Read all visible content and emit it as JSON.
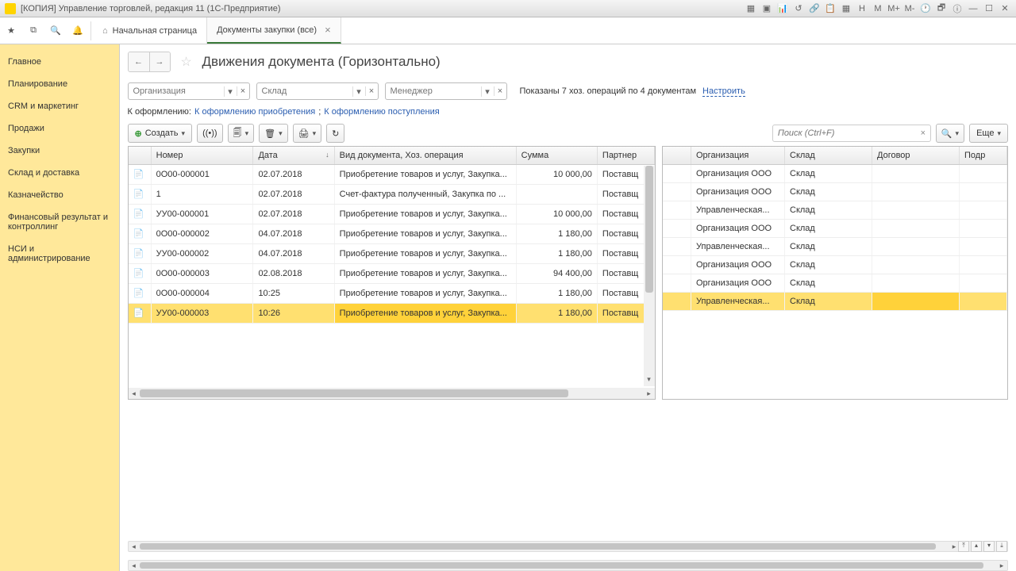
{
  "window": {
    "title": "[КОПИЯ] Управление торговлей, редакция 11 (1С-Предприятие)"
  },
  "tabs": {
    "home": "Начальная страница",
    "active": "Документы закупки (все)"
  },
  "nav": [
    "Главное",
    "Планирование",
    "CRM и маркетинг",
    "Продажи",
    "Закупки",
    "Склад и доставка",
    "Казначейство",
    "Финансовый результат и контроллинг",
    "НСИ и администрирование"
  ],
  "header": {
    "title": "Движения документа (Горизонтально)"
  },
  "filters": {
    "org_ph": "Организация",
    "sklad_ph": "Склад",
    "manager_ph": "Менеджер",
    "summary": "Показаны 7 хоз. операций по 4 документам",
    "configure": "Настроить"
  },
  "sublinks": {
    "label": "К оформлению:",
    "l1": "К оформлению приобретения",
    "l2": "К оформлению поступления"
  },
  "toolbar": {
    "create": "Создать",
    "search_ph": "Поиск (Ctrl+F)",
    "more": "Еще"
  },
  "cols_left": {
    "num": "Номер",
    "date": "Дата",
    "type": "Вид документа, Хоз. операция",
    "sum": "Сумма",
    "partner": "Партнер"
  },
  "cols_right": {
    "org": "Организация",
    "sklad": "Склад",
    "dogovor": "Договор",
    "podr": "Подр"
  },
  "rows_left": [
    {
      "num": "0О00-000001",
      "date": "02.07.2018",
      "type": "Приобретение товаров и услуг, Закупка...",
      "sum": "10 000,00",
      "partner": "Поставщ"
    },
    {
      "num": "1",
      "date": "02.07.2018",
      "type": "Счет-фактура полученный, Закупка по ...",
      "sum": "",
      "partner": "Поставщ"
    },
    {
      "num": "УУ00-000001",
      "date": "02.07.2018",
      "type": "Приобретение товаров и услуг, Закупка...",
      "sum": "10 000,00",
      "partner": "Поставщ"
    },
    {
      "num": "0О00-000002",
      "date": "04.07.2018",
      "type": "Приобретение товаров и услуг, Закупка...",
      "sum": "1 180,00",
      "partner": "Поставщ"
    },
    {
      "num": "УУ00-000002",
      "date": "04.07.2018",
      "type": "Приобретение товаров и услуг, Закупка...",
      "sum": "1 180,00",
      "partner": "Поставщ"
    },
    {
      "num": "0О00-000003",
      "date": "02.08.2018",
      "type": "Приобретение товаров и услуг, Закупка...",
      "sum": "94 400,00",
      "partner": "Поставщ"
    },
    {
      "num": "0О00-000004",
      "date": "10:25",
      "type": "Приобретение товаров и услуг, Закупка...",
      "sum": "1 180,00",
      "partner": "Поставщ"
    },
    {
      "num": "УУ00-000003",
      "date": "10:26",
      "type": "Приобретение товаров и услуг, Закупка...",
      "sum": "1 180,00",
      "partner": "Поставщ"
    }
  ],
  "rows_right": [
    {
      "org": "Организация ООО",
      "sklad": "Склад"
    },
    {
      "org": "Организация ООО",
      "sklad": "Склад"
    },
    {
      "org": "Управленческая...",
      "sklad": "Склад"
    },
    {
      "org": "Организация ООО",
      "sklad": "Склад"
    },
    {
      "org": "Управленческая...",
      "sklad": "Склад"
    },
    {
      "org": "Организация ООО",
      "sklad": "Склад"
    },
    {
      "org": "Организация ООО",
      "sklad": "Склад"
    },
    {
      "org": "Управленческая...",
      "sklad": "Склад"
    }
  ],
  "selected_row": 7,
  "top_icons": [
    "H",
    "M",
    "M+",
    "M-"
  ]
}
